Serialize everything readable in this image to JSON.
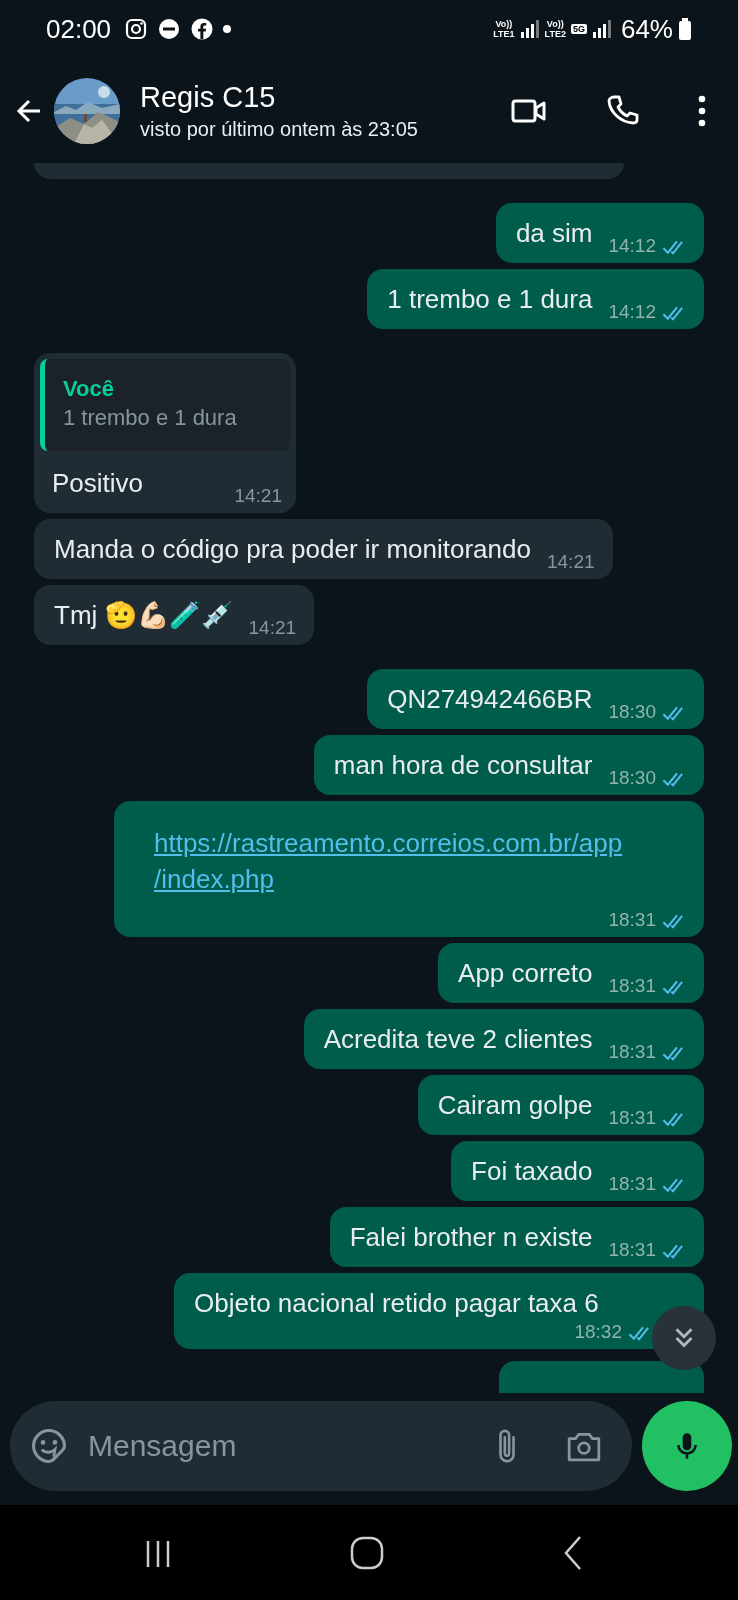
{
  "status_bar": {
    "time": "02:00",
    "sims": [
      {
        "label": "Vo))",
        "network": "LTE1"
      },
      {
        "label": "Vo))",
        "network": "LTE2",
        "badge": "5G"
      }
    ],
    "battery": "64%"
  },
  "header": {
    "name": "Regis C15",
    "last_seen": "visto por último ontem às 23:05"
  },
  "messages": [
    {
      "kind": "fragment",
      "outgoing": false
    },
    {
      "kind": "text",
      "outgoing": true,
      "text": "da sim",
      "time": "14:12",
      "read": true
    },
    {
      "kind": "text",
      "outgoing": true,
      "text": "1 trembo e 1 dura",
      "time": "14:12",
      "read": true
    },
    {
      "kind": "reply",
      "outgoing": false,
      "quote_author": "Você",
      "quote_text": "1 trembo e 1 dura",
      "text": "Positivo",
      "time": "14:21"
    },
    {
      "kind": "text",
      "outgoing": false,
      "text": "Manda o código pra poder ir monitorando",
      "time": "14:21"
    },
    {
      "kind": "text",
      "outgoing": false,
      "text": "Tmj 🫡💪🏻🧪💉",
      "time": "14:21"
    },
    {
      "kind": "text",
      "outgoing": true,
      "text": "QN274942466BR",
      "time": "18:30",
      "read": true
    },
    {
      "kind": "text",
      "outgoing": true,
      "text": "man hora de consultar",
      "time": "18:30",
      "read": true
    },
    {
      "kind": "link",
      "outgoing": true,
      "text": "https://rastreamento.correios.com.br/app/index.php",
      "time": "18:31",
      "read": true
    },
    {
      "kind": "text",
      "outgoing": true,
      "text": "App correto",
      "time": "18:31",
      "read": true
    },
    {
      "kind": "text",
      "outgoing": true,
      "text": "Acredita teve 2 clientes",
      "time": "18:31",
      "read": true
    },
    {
      "kind": "text",
      "outgoing": true,
      "text": "Cairam golpe",
      "time": "18:31",
      "read": true
    },
    {
      "kind": "text",
      "outgoing": true,
      "text": "Foi taxado",
      "time": "18:31",
      "read": true
    },
    {
      "kind": "text",
      "outgoing": true,
      "text": "Falei brother n existe",
      "time": "18:31",
      "read": true
    },
    {
      "kind": "long",
      "outgoing": true,
      "text": "Objeto nacional retido pagar taxa 6",
      "time": "18:32",
      "read": true
    },
    {
      "kind": "fragment",
      "outgoing": true
    }
  ],
  "composer": {
    "placeholder": "Mensagem"
  }
}
